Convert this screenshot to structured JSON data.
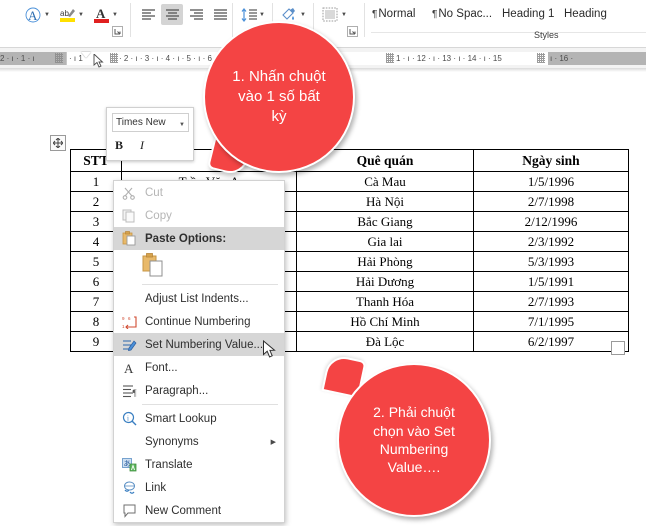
{
  "ribbon": {
    "font_group": {
      "text_effects_icon": "text-effects-icon",
      "highlight_icon": "text-highlight-icon",
      "font_color_icon": "font-color-icon",
      "launcher": "⤵"
    },
    "paragraph_group": {
      "align_left_icon": "align-left-icon",
      "align_center_icon": "align-center-icon",
      "align_right_icon": "align-right-icon",
      "align_justify_icon": "align-justify-icon",
      "line_spacing_icon": "line-spacing-icon",
      "shading_icon": "shading-icon",
      "borders_icon": "borders-icon",
      "launcher": "⤵"
    },
    "styles_group": {
      "label": "Styles",
      "items": [
        {
          "pilcrow": "¶",
          "label": "Normal"
        },
        {
          "pilcrow": "¶",
          "label": "No Spac..."
        },
        {
          "pilcrow": "",
          "label": "Heading 1"
        },
        {
          "pilcrow": "",
          "label": "Heading "
        }
      ]
    }
  },
  "ruler": {
    "left_ticks": "2  ·  ı  ·  1  ·  ı ",
    "white_ticks_a": " ·  ı       1 ",
    "white_ticks_b": " ·  2  ·  ı  ·  3  ·  ı  ·  4  ·  ı  ·  5  ·  ı  ·  6  ·  ı  ·  7  ·  ı  ·  8  ·  ı  ·  9  ·  ı  · 10 ·  ı ",
    "white_ticks_c": " 1  ·  ı  · 12 ·  ı  · 13 ·  ı  · 14 ·  ı  · 15",
    "right_ticks": " ı  · 16 ·"
  },
  "mini_toolbar": {
    "font_name": "Times New",
    "bold_label": "B",
    "italic_label": "I",
    "dropdown_icon": "chevron-down-icon"
  },
  "context_menu": {
    "items": [
      {
        "label": "Cut",
        "icon": "scissors-icon",
        "state": "disabled",
        "underline": "t"
      },
      {
        "label": "Copy",
        "icon": "copy-icon",
        "state": "disabled",
        "underline": "C"
      },
      {
        "label": "Paste Options:",
        "icon": "paste-icon",
        "state": "header"
      },
      {
        "label": "",
        "icon": "paste-keep-formatting-icon",
        "state": "paste-gallery"
      },
      {
        "label": "Adjust List Indents...",
        "icon": "",
        "state": "normal"
      },
      {
        "label": "Continue Numbering",
        "icon": "continue-numbering-icon",
        "state": "normal"
      },
      {
        "label": "Set Numbering Value...",
        "icon": "set-numbering-value-icon",
        "state": "highlight"
      },
      {
        "label": "Font...",
        "icon": "font-A-icon",
        "state": "normal"
      },
      {
        "label": "Paragraph...",
        "icon": "paragraph-icon",
        "state": "normal"
      },
      {
        "label": "Smart Lookup",
        "icon": "smart-lookup-icon",
        "state": "normal"
      },
      {
        "label": "Synonyms",
        "icon": "",
        "state": "submenu"
      },
      {
        "label": "Translate",
        "icon": "translate-icon",
        "state": "normal"
      },
      {
        "label": "Link",
        "icon": "link-icon",
        "state": "normal"
      },
      {
        "label": "New Comment",
        "icon": "new-comment-icon",
        "state": "normal"
      }
    ],
    "submenu_arrow": "▶"
  },
  "table": {
    "headers": [
      "STT",
      "",
      "Quê quán",
      "Ngày sinh"
    ],
    "rows": [
      {
        "stt": "1",
        "name": "Trần Văn A",
        "que": "Cà Mau",
        "ngay": "1/5/1996"
      },
      {
        "stt": "2",
        "name": "",
        "que": "Hà Nội",
        "ngay": "2/7/1998"
      },
      {
        "stt": "3",
        "name": "",
        "que": "Bắc Giang",
        "ngay": "2/12/1996"
      },
      {
        "stt": "4",
        "name": "",
        "que": "Gia lai",
        "ngay": "2/3/1992"
      },
      {
        "stt": "5",
        "name": "",
        "que": "Hải Phòng",
        "ngay": "5/3/1993"
      },
      {
        "stt": "6",
        "name": "",
        "que": "Hải Dương",
        "ngay": "1/5/1991"
      },
      {
        "stt": "7",
        "name": "",
        "que": "Thanh Hóa",
        "ngay": "2/7/1993"
      },
      {
        "stt": "8",
        "name": "",
        "que": "Hồ Chí Minh",
        "ngay": "7/1/1995"
      },
      {
        "stt": "9",
        "name": "",
        "que": "Đà Lộc",
        "ngay": "6/2/1997"
      }
    ]
  },
  "callouts": [
    {
      "id": "bubble1",
      "text": "1. Nhấn chuột\nvào 1 số bất\nkỳ",
      "color": "#f44444"
    },
    {
      "id": "bubble2",
      "text": "2. Phải chuột\nchọn vào Set\nNumbering\nValue….",
      "color": "#f44444"
    }
  ],
  "colors": {
    "callout_red": "#f44444",
    "menu_highlight": "#d6d6d6",
    "ribbon_bg": "#ffffff",
    "ruler_bg": "#f3f3f3"
  }
}
